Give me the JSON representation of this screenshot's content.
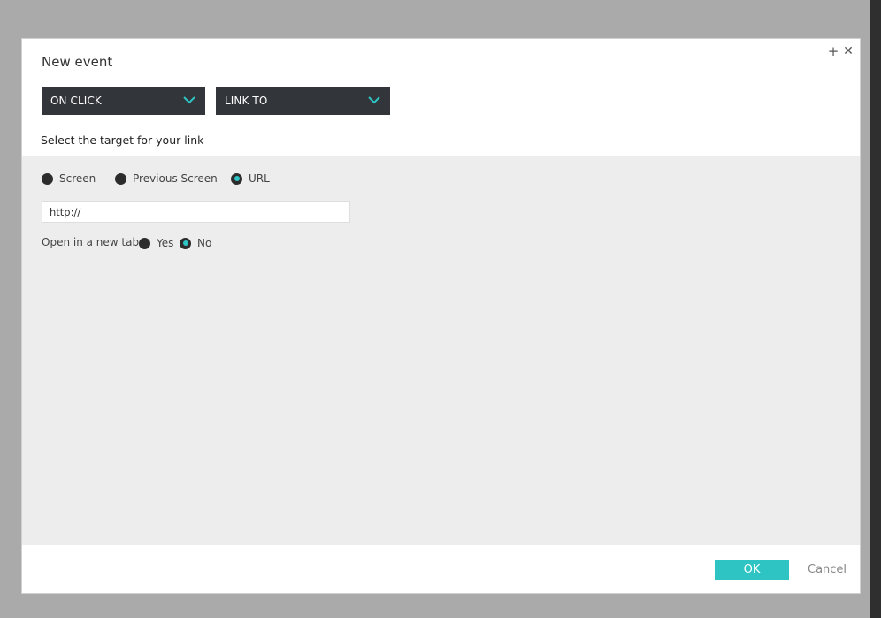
{
  "dialog": {
    "title": "New event",
    "add_icon": "plus-icon",
    "close_icon": "close-icon"
  },
  "dropdowns": {
    "trigger": {
      "value": "ON CLICK",
      "icon": "chevron-down-icon"
    },
    "action": {
      "value": "LINK TO",
      "icon": "chevron-down-icon"
    }
  },
  "prompt": "Select the target for your link",
  "target_options": [
    {
      "label": "Screen",
      "selected": false
    },
    {
      "label": "Previous Screen",
      "selected": false
    },
    {
      "label": "URL",
      "selected": true
    }
  ],
  "url_field": {
    "value": "http://"
  },
  "new_tab": {
    "label": "Open in a new tab:",
    "options": [
      {
        "label": "Yes",
        "selected": false
      },
      {
        "label": "No",
        "selected": true
      }
    ]
  },
  "footer": {
    "ok_label": "OK",
    "cancel_label": "Cancel"
  },
  "colors": {
    "accent": "#2ec4c4",
    "dropdown_bg": "#32353a",
    "panel_bg": "#ededed",
    "overlay": "#aaaaaa"
  }
}
